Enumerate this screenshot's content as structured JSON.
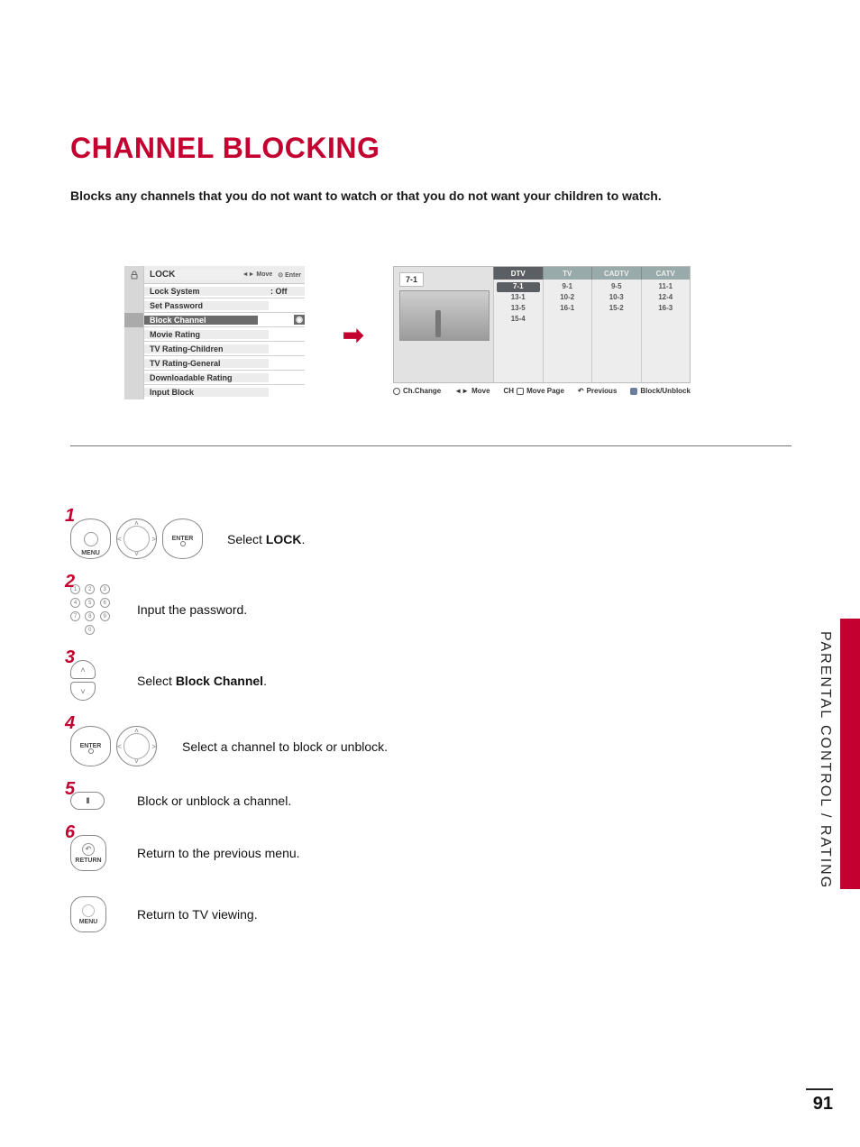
{
  "title": "CHANNEL BLOCKING",
  "intro": "Blocks any channels that you do not want to watch or that you do not want your children to watch.",
  "side_label": "PARENTAL CONTROL / RATING",
  "page_number": "91",
  "lock_menu": {
    "title": "LOCK",
    "hint_move": "Move",
    "hint_enter": "Enter",
    "items": [
      {
        "label": "Lock System",
        "value": ": Off"
      },
      {
        "label": "Set Password",
        "value": ""
      },
      {
        "label": "Block Channel",
        "value": "",
        "selected": true,
        "bullet": true
      },
      {
        "label": "Movie Rating",
        "value": ""
      },
      {
        "label": "TV Rating-Children",
        "value": ""
      },
      {
        "label": "TV Rating-General",
        "value": ""
      },
      {
        "label": "Downloadable Rating",
        "value": ""
      },
      {
        "label": "Input Block",
        "value": ""
      }
    ]
  },
  "channel_list": {
    "current": "7-1",
    "tabs": [
      "DTV",
      "TV",
      "CADTV",
      "CATV"
    ],
    "active_tab": 0,
    "columns": [
      [
        "7-1",
        "13-1",
        "13-5",
        "15-4"
      ],
      [
        "9-1",
        "10-2",
        "16-1"
      ],
      [
        "9-5",
        "10-3",
        "15-2"
      ],
      [
        "11-1",
        "12-4",
        "16-3"
      ]
    ],
    "selected_cell": "7-1",
    "hints": {
      "chchange": "Ch.Change",
      "move": "Move",
      "movepage_prefix": "CH",
      "movepage": "Move Page",
      "previous": "Previous",
      "block": "Block/Unblock"
    }
  },
  "buttons": {
    "menu": "MENU",
    "enter": "ENTER",
    "return": "RETURN"
  },
  "steps": [
    {
      "num": "1",
      "text_pre": "Select ",
      "bold": "LOCK",
      "text_post": "."
    },
    {
      "num": "2",
      "text_pre": "Input the password.",
      "bold": "",
      "text_post": ""
    },
    {
      "num": "3",
      "text_pre": "Select ",
      "bold": "Block Channel",
      "text_post": "."
    },
    {
      "num": "4",
      "text_pre": "Select a channel to block or unblock.",
      "bold": "",
      "text_post": ""
    },
    {
      "num": "5",
      "text_pre": "Block or unblock a channel.",
      "bold": "",
      "text_post": ""
    },
    {
      "num": "6",
      "text_pre": "Return to the previous menu.",
      "bold": "",
      "text_post": ""
    }
  ],
  "step_final": "Return to TV viewing."
}
